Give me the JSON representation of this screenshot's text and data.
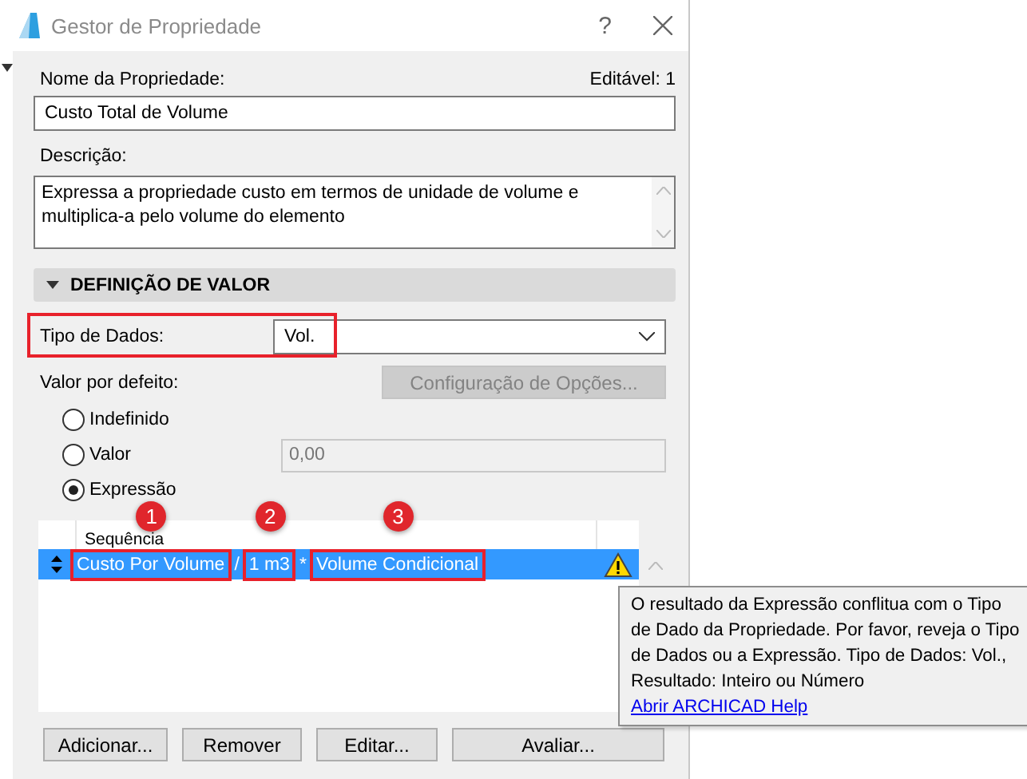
{
  "window": {
    "title": "Gestor de Propriedade",
    "help": "?"
  },
  "property_name": {
    "label": "Nome da Propriedade:",
    "value": "Custo Total de Volume"
  },
  "editable": "Editável: 1",
  "description": {
    "label": "Descrição:",
    "value": "Expressa a propriedade custo em termos de unidade de volume e multiplica-a pelo volume do elemento"
  },
  "section": {
    "title": "DEFINIÇÃO DE VALOR",
    "expanded": true
  },
  "data_type": {
    "label": "Tipo de Dados:",
    "value": "Vol.",
    "highlighted": true
  },
  "default_value": {
    "label": "Valor por defeito:",
    "options_button": {
      "label": "Configuração de Opções...",
      "disabled": true
    },
    "options": [
      {
        "label": "Indefinido",
        "selected": false
      },
      {
        "label": "Valor",
        "selected": false,
        "value": "0,00",
        "field_disabled": true
      },
      {
        "label": "Expressão",
        "selected": true
      }
    ]
  },
  "expression_list": {
    "columns": [
      "Sequência"
    ],
    "rows": [
      {
        "selected": true,
        "warning": true,
        "tokens": [
          {
            "text": "Custo Por Volume",
            "badge": "1"
          },
          {
            "text": "/"
          },
          {
            "text": "1 m3",
            "badge": "2"
          },
          {
            "text": "*"
          },
          {
            "text": "Volume Condicional",
            "badge": "3"
          }
        ]
      }
    ]
  },
  "buttons": [
    "Adicionar...",
    "Remover",
    "Editar...",
    "Avaliar..."
  ],
  "tooltip": {
    "message": "O resultado da Expressão conflitua com o Tipo de Dado da Propriedade. Por favor, reveja o Tipo de Dados ou a Expressão. Tipo de Dados: Vol., Resultado: Inteiro ou Número",
    "link": "Abrir ARCHICAD Help"
  }
}
